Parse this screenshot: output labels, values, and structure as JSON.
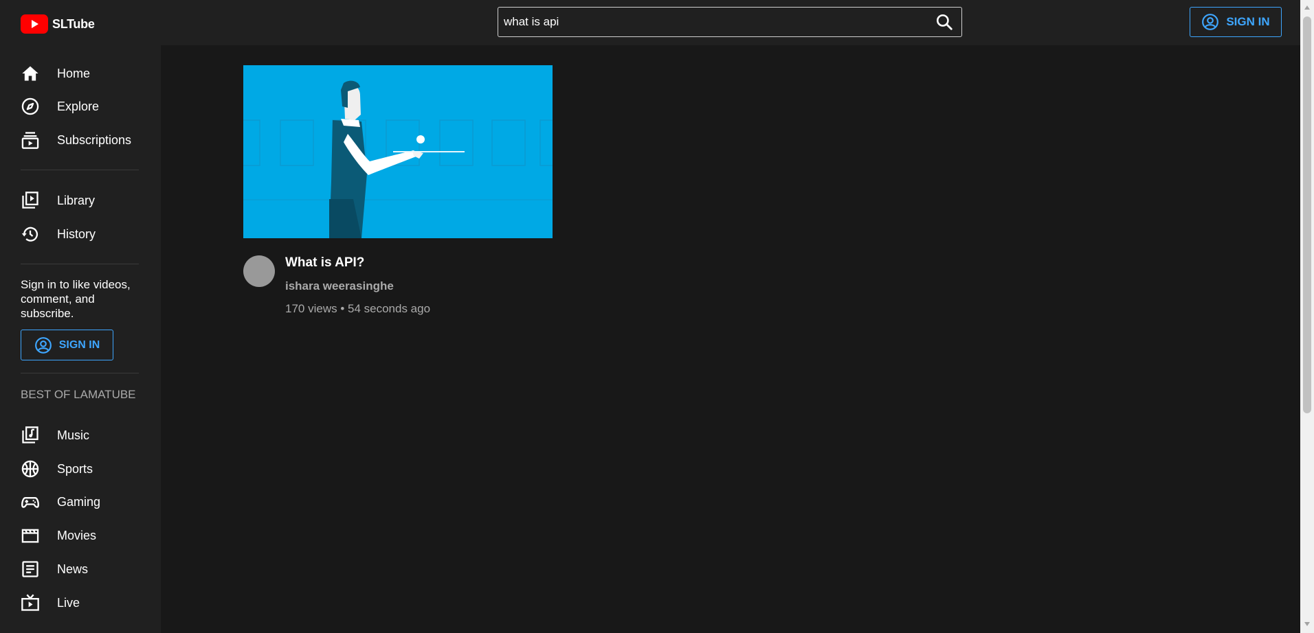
{
  "brand": {
    "name": "SLTube",
    "logo_color": "#ff0000"
  },
  "search": {
    "value": "what is api",
    "icon": "search-icon"
  },
  "header": {
    "sign_in_label": "SIGN IN",
    "accent": "#3ea6ff"
  },
  "sidebar": {
    "primary": [
      {
        "label": "Home",
        "icon": "home-icon"
      },
      {
        "label": "Explore",
        "icon": "compass-icon"
      },
      {
        "label": "Subscriptions",
        "icon": "subscriptions-icon"
      }
    ],
    "secondary": [
      {
        "label": "Library",
        "icon": "library-icon"
      },
      {
        "label": "History",
        "icon": "history-icon"
      }
    ],
    "sign_in_prompt": "Sign in to like videos, comment, and subscribe.",
    "sign_in_label": "SIGN IN",
    "section_title": "BEST OF LAMATUBE",
    "categories": [
      {
        "label": "Music",
        "icon": "music-icon"
      },
      {
        "label": "Sports",
        "icon": "sports-icon"
      },
      {
        "label": "Gaming",
        "icon": "gaming-icon"
      },
      {
        "label": "Movies",
        "icon": "movies-icon"
      },
      {
        "label": "News",
        "icon": "news-icon"
      },
      {
        "label": "Live",
        "icon": "live-icon"
      }
    ]
  },
  "video": {
    "title": "What is API?",
    "channel": "ishara weerasinghe",
    "stats": "170 views • 54 seconds ago",
    "thumbnail_color": "#00a9e5"
  }
}
